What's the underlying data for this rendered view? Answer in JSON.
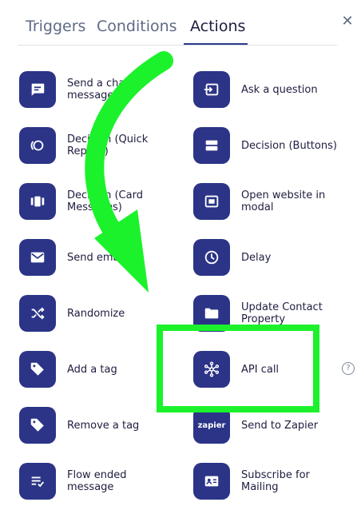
{
  "tabs": [
    {
      "label": "Triggers"
    },
    {
      "label": "Conditions"
    },
    {
      "label": "Actions"
    }
  ],
  "active_tab": "Actions",
  "close_glyph": "✕",
  "help_glyph": "?",
  "colors": {
    "tile": "#2b3487",
    "highlight": "#1bf22b",
    "text": "#1d1d3f",
    "tab_inactive": "#5e6a86"
  },
  "actions": [
    {
      "label": "Send a chat message",
      "icon": "chat-icon"
    },
    {
      "label": "Ask a question",
      "icon": "input-icon"
    },
    {
      "label": "Decision (Quick Replies)",
      "icon": "quick-reply-icon"
    },
    {
      "label": "Decision (Buttons)",
      "icon": "buttons-icon"
    },
    {
      "label": "Decision (Card Messages)",
      "icon": "carousel-icon"
    },
    {
      "label": "Open website in modal",
      "icon": "modal-icon"
    },
    {
      "label": "Send email",
      "icon": "email-icon"
    },
    {
      "label": "Delay",
      "icon": "clock-icon"
    },
    {
      "label": "Randomize",
      "icon": "shuffle-icon"
    },
    {
      "label": "Update Contact Property",
      "icon": "folder-icon"
    },
    {
      "label": "Add a tag",
      "icon": "tag-icon"
    },
    {
      "label": "API call",
      "icon": "api-hub-icon"
    },
    {
      "label": "Remove a tag",
      "icon": "tag-remove-icon"
    },
    {
      "label": "Send to Zapier",
      "icon": "zapier-icon",
      "icon_text": "zapier"
    },
    {
      "label": "Flow ended message",
      "icon": "flow-end-icon"
    },
    {
      "label": "Subscribe for Mailing",
      "icon": "contact-card-icon"
    }
  ]
}
